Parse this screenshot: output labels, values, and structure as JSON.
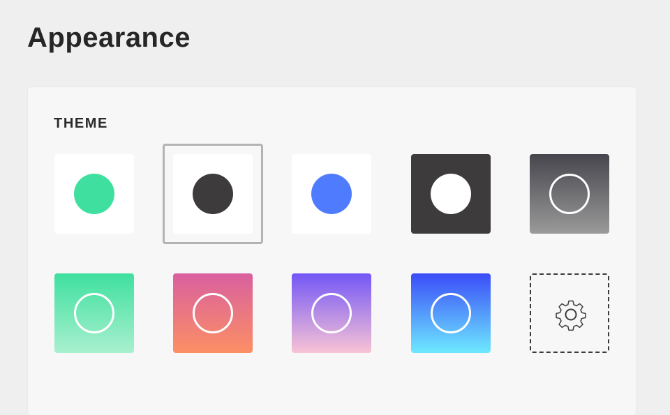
{
  "page": {
    "title": "Appearance"
  },
  "theme": {
    "section_label": "THEME",
    "selected_index": 1,
    "swatches": [
      {
        "name": "light-green",
        "background": "#ffffff",
        "accent": "#3fe09f",
        "style": "dot"
      },
      {
        "name": "light-dark",
        "background": "#ffffff",
        "accent": "#3d3b3c",
        "style": "dot"
      },
      {
        "name": "light-blue",
        "background": "#ffffff",
        "accent": "#4f7bff",
        "style": "dot"
      },
      {
        "name": "dark",
        "background": "#3d3b3c",
        "accent": "#ffffff",
        "style": "dot"
      },
      {
        "name": "gray-gradient",
        "gradient": [
          "#47464d",
          "#9a9a9a"
        ],
        "style": "ring"
      },
      {
        "name": "green-gradient",
        "gradient": [
          "#3fe09f",
          "#a9f0cf"
        ],
        "style": "ring"
      },
      {
        "name": "pink-orange-gradient",
        "gradient": [
          "#d9609f",
          "#fc8f64"
        ],
        "style": "ring"
      },
      {
        "name": "purple-pink-gradient",
        "gradient": [
          "#7357f6",
          "#f8c3d5"
        ],
        "style": "ring"
      },
      {
        "name": "blue-cyan-gradient",
        "gradient": [
          "#3b4cf8",
          "#6ee9ff"
        ],
        "style": "ring"
      }
    ],
    "custom_button": {
      "icon": "gear-icon"
    }
  }
}
